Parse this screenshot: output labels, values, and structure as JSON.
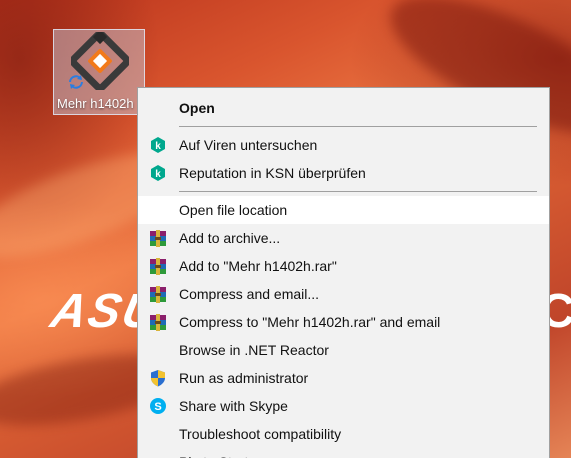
{
  "desktop": {
    "brand_text": "ASUS",
    "brand_right_text": "C",
    "icon": {
      "label": "Mehr h1402h",
      "icon_name": "app-logo-icon",
      "badge_icon_name": "sync-icon"
    }
  },
  "menu": {
    "items": [
      {
        "label": "Open",
        "bold": true,
        "icon": ""
      },
      {
        "label": "Auf Viren untersuchen",
        "icon": "kaspersky-icon"
      },
      {
        "label": "Reputation in KSN überprüfen",
        "icon": "kaspersky-icon"
      },
      {
        "label": "Open file location",
        "icon": ""
      },
      {
        "label": "Add to archive...",
        "icon": "winrar-icon"
      },
      {
        "label": "Add to \"Mehr h1402h.rar\"",
        "icon": "winrar-icon"
      },
      {
        "label": "Compress and email...",
        "icon": "winrar-icon"
      },
      {
        "label": "Compress to \"Mehr h1402h.rar\" and email",
        "icon": "winrar-icon"
      },
      {
        "label": "Browse in .NET Reactor",
        "icon": ""
      },
      {
        "label": "Run as administrator",
        "icon": "uac-shield-icon"
      },
      {
        "label": "Share with Skype",
        "icon": "skype-icon"
      },
      {
        "label": "Troubleshoot compatibility",
        "icon": ""
      },
      {
        "label": "Pin to Start",
        "icon": ""
      }
    ]
  },
  "colors": {
    "kaspersky": "#00a88e",
    "skype": "#00aff0",
    "menu_bg": "#f2f2f2",
    "highlight_bg": "#ffffff"
  }
}
